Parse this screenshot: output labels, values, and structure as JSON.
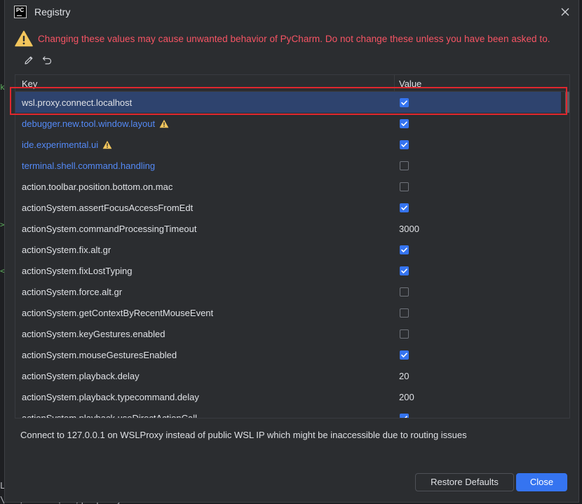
{
  "window": {
    "title": "Registry",
    "app_icon_text": "PC"
  },
  "warning": {
    "text": "Changing these values may cause unwanted behavior of PyCharm. Do not change these unless you have been asked to."
  },
  "toolbar": {
    "edit_icon": "pencil-icon",
    "revert_icon": "undo-icon"
  },
  "table": {
    "columns": [
      "Key",
      "Value"
    ],
    "rows": [
      {
        "key": "wsl.proxy.connect.localhost",
        "type": "checkbox",
        "checked": true,
        "changed": false,
        "warning": false,
        "selected": true
      },
      {
        "key": "debugger.new.tool.window.layout",
        "type": "checkbox",
        "checked": true,
        "changed": true,
        "warning": true
      },
      {
        "key": "ide.experimental.ui",
        "type": "checkbox",
        "checked": true,
        "changed": true,
        "warning": true
      },
      {
        "key": "terminal.shell.command.handling",
        "type": "checkbox",
        "checked": false,
        "changed": true,
        "warning": false
      },
      {
        "key": "action.toolbar.position.bottom.on.mac",
        "type": "checkbox",
        "checked": false,
        "changed": false,
        "warning": false
      },
      {
        "key": "actionSystem.assertFocusAccessFromEdt",
        "type": "checkbox",
        "checked": true,
        "changed": false,
        "warning": false
      },
      {
        "key": "actionSystem.commandProcessingTimeout",
        "type": "text",
        "value": "3000",
        "changed": false,
        "warning": false
      },
      {
        "key": "actionSystem.fix.alt.gr",
        "type": "checkbox",
        "checked": true,
        "changed": false,
        "warning": false
      },
      {
        "key": "actionSystem.fixLostTyping",
        "type": "checkbox",
        "checked": true,
        "changed": false,
        "warning": false
      },
      {
        "key": "actionSystem.force.alt.gr",
        "type": "checkbox",
        "checked": false,
        "changed": false,
        "warning": false
      },
      {
        "key": "actionSystem.getContextByRecentMouseEvent",
        "type": "checkbox",
        "checked": false,
        "changed": false,
        "warning": false
      },
      {
        "key": "actionSystem.keyGestures.enabled",
        "type": "checkbox",
        "checked": false,
        "changed": false,
        "warning": false
      },
      {
        "key": "actionSystem.mouseGesturesEnabled",
        "type": "checkbox",
        "checked": true,
        "changed": false,
        "warning": false
      },
      {
        "key": "actionSystem.playback.delay",
        "type": "text",
        "value": "20",
        "changed": false,
        "warning": false
      },
      {
        "key": "actionSystem.playback.typecommand.delay",
        "type": "text",
        "value": "200",
        "changed": false,
        "warning": false
      },
      {
        "key": "actionSystem.playback.useDirectActionCall",
        "type": "checkbox",
        "checked": true,
        "changed": false,
        "warning": false
      }
    ]
  },
  "description": "Connect to 127.0.0.1 on WSLProxy instead of public WSL IP which might be inaccessible due to routing issues",
  "buttons": {
    "restore_defaults": "Restore Defaults",
    "close": "Close"
  },
  "background": {
    "bottom_line": "\\s*</value>\\s*</property>",
    "left_fragment": "Le"
  },
  "colors": {
    "accent": "#3574f0",
    "warning_text": "#f75464",
    "changed_key": "#548af7",
    "selection": "#2e436e",
    "highlight_box": "#e0272e"
  }
}
